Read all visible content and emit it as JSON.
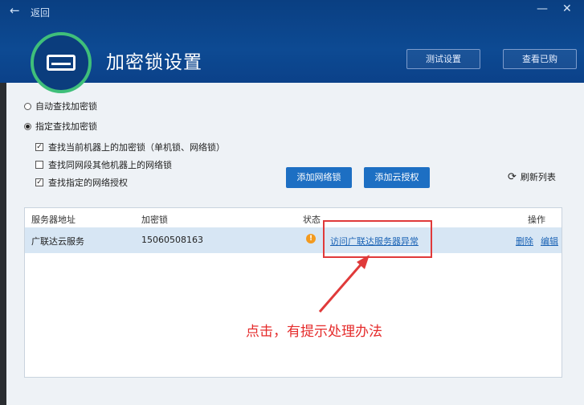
{
  "topbar": {
    "back_label": "返回",
    "min": "—",
    "close": "✕"
  },
  "header": {
    "title": "加密锁设置",
    "btn_test": "测试设置",
    "btn_view": "查看已购"
  },
  "options": {
    "auto_find": "自动查找加密锁",
    "specified_find": "指定查找加密锁",
    "check_local": "查找当前机器上的加密锁（单机锁、网络锁）",
    "check_segment": "查找同网段其他机器上的网络锁",
    "check_network_auth": "查找指定的网络授权",
    "check_mark": "✓"
  },
  "buttons": {
    "add_network_lock": "添加网络锁",
    "add_cloud_auth": "添加云授权",
    "refresh": "刷新列表",
    "refresh_icon": "⟳"
  },
  "table": {
    "headers": {
      "server": "服务器地址",
      "lock": "加密锁",
      "status": "状态",
      "ops": "操作"
    },
    "rows": [
      {
        "server": "广联达云服务",
        "lock": "15060508163",
        "status_icon": "!",
        "status_link": "访问广联达服务器异常",
        "delete": "删除",
        "edit": "编辑"
      }
    ]
  },
  "annotation": {
    "text": "点击，有提示处理办法",
    "color": "#e52b2b"
  }
}
